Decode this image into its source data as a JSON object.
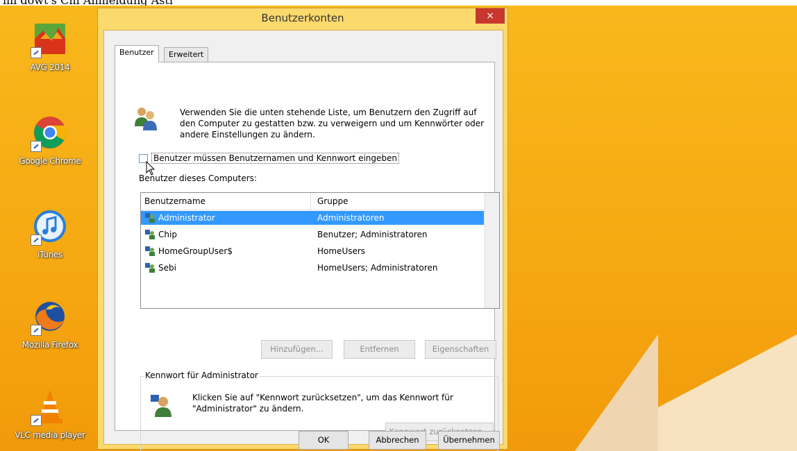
{
  "top_caption": "mi dowt's Chi Anmeldung Asti",
  "desktop": {
    "icons": [
      {
        "label": "AVG 2014",
        "icon": "avg-icon"
      },
      {
        "label": "Google Chrome",
        "icon": "chrome-icon"
      },
      {
        "label": "iTunes",
        "icon": "itunes-icon"
      },
      {
        "label": "Mozilla Firefox",
        "icon": "firefox-icon"
      },
      {
        "label": "VLC media player",
        "icon": "vlc-icon"
      }
    ]
  },
  "dialog": {
    "title": "Benutzerkonten",
    "close_glyph": "×",
    "tabs": [
      {
        "label": "Benutzer",
        "active": true
      },
      {
        "label": "Erweitert",
        "active": false
      }
    ],
    "intro_text": "Verwenden Sie die unten stehende Liste, um Benutzern den Zugriff auf den Computer zu gestatten bzw. zu verweigern und um Kennwörter oder andere Einstellungen zu ändern.",
    "login_checkbox_label": "Benutzer müssen Benutzernamen und Kennwort eingeben",
    "login_checkbox_checked": false,
    "users_heading": "Benutzer dieses Computers:",
    "columns": {
      "name": "Benutzername",
      "group": "Gruppe"
    },
    "users": [
      {
        "name": "Administrator",
        "group": "Administratoren",
        "selected": true
      },
      {
        "name": "Chip",
        "group": "Benutzer; Administratoren",
        "selected": false
      },
      {
        "name": "HomeGroupUser$",
        "group": "HomeUsers",
        "selected": false
      },
      {
        "name": "Sebi",
        "group": "HomeUsers; Administratoren",
        "selected": false
      }
    ],
    "buttons": {
      "add": "Hinzufügen...",
      "remove": "Entfernen",
      "properties": "Eigenschaften"
    },
    "password_group": {
      "legend": "Kennwort für Administrator",
      "text": "Klicken Sie auf \"Kennwort zurücksetzen\", um das Kennwort für \"Administrator\" zu ändern.",
      "reset_button": "Kennwort zurücksetzen..."
    },
    "footer": {
      "ok": "OK",
      "cancel": "Abbrechen",
      "apply": "Übernehmen"
    }
  },
  "colors": {
    "desktop": "#f6a912",
    "dialog_frame": "#fbd96c",
    "close": "#c7372e",
    "selection": "#3399ff"
  }
}
